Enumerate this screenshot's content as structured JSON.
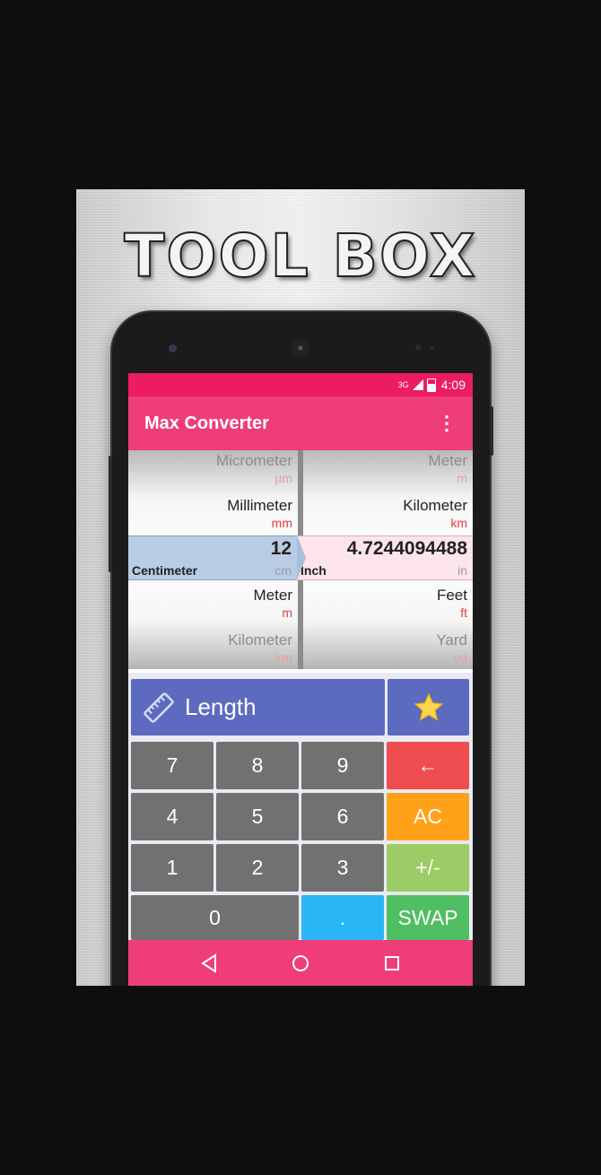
{
  "promo": {
    "title": "TOOL BOX"
  },
  "status_bar": {
    "network": "3G",
    "time": "4:09"
  },
  "toolbar": {
    "title": "Max Converter",
    "menu_icon": "more-vert-icon"
  },
  "wheels": {
    "left": {
      "items": [
        {
          "name": "Micrometer",
          "abbr": "µm"
        },
        {
          "name": "Millimeter",
          "abbr": "mm"
        },
        {
          "name": "Meter",
          "abbr": "m"
        },
        {
          "name": "Kilometer",
          "abbr": "km"
        }
      ],
      "selected": {
        "value": "12",
        "name": "Centimeter",
        "abbr": "cm"
      }
    },
    "right": {
      "items": [
        {
          "name": "Meter",
          "abbr": "m"
        },
        {
          "name": "Kilometer",
          "abbr": "km"
        },
        {
          "name": "Feet",
          "abbr": "ft"
        },
        {
          "name": "Yard",
          "abbr": "yd"
        }
      ],
      "selected": {
        "value": "4.7244094488",
        "name": "Inch",
        "abbr": "in"
      }
    }
  },
  "category": {
    "label": "Length",
    "icon": "ruler-icon",
    "favorite_icon": "star-icon"
  },
  "keypad": {
    "k7": "7",
    "k8": "8",
    "k9": "9",
    "backspace": "←",
    "k4": "4",
    "k5": "5",
    "k6": "6",
    "clear": "AC",
    "k1": "1",
    "k2": "2",
    "k3": "3",
    "sign": "+/-",
    "k0": "0",
    "dot": ".",
    "swap": "SWAP"
  },
  "colors": {
    "status_bar": "#ec1c63",
    "toolbar": "#ee3d78",
    "category": "#5c6bc0",
    "number_key": "#717171",
    "backspace": "#ef4c4f",
    "clear": "#ffa21a",
    "sign": "#9ccc65",
    "swap": "#50be62",
    "dot": "#29b6f6"
  }
}
